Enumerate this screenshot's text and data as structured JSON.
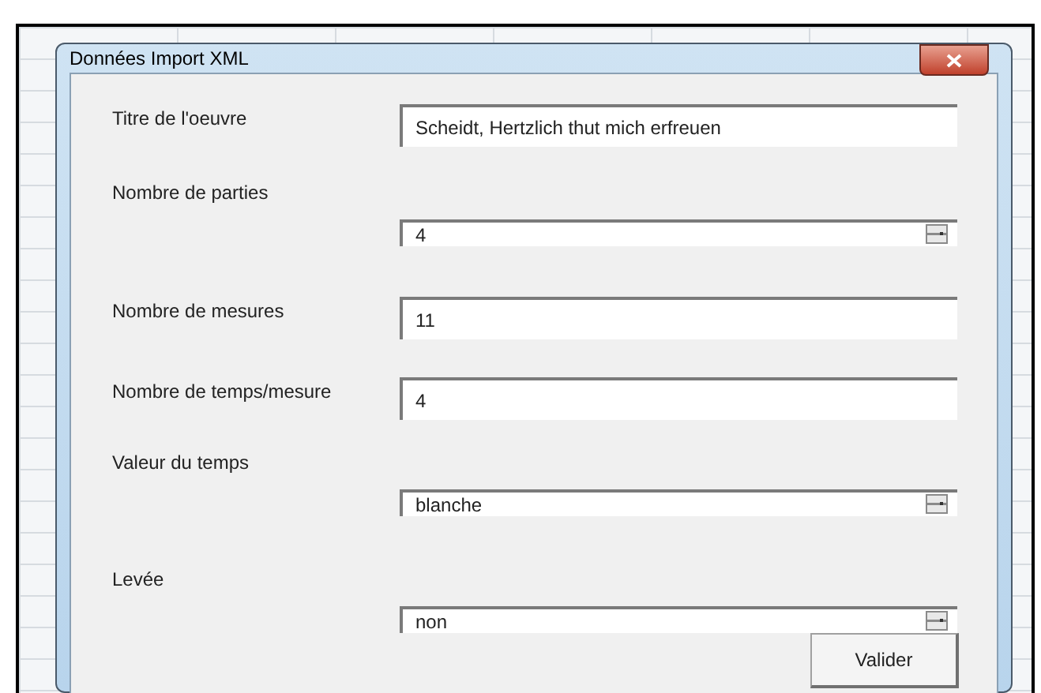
{
  "window": {
    "title": "Données Import XML"
  },
  "fields": [
    {
      "label": "Titre de l'oeuvre",
      "kind": "text",
      "value": "Scheidt, Hertzlich thut mich erfreuen"
    },
    {
      "label": "Nombre de parties",
      "kind": "spin",
      "value": "4"
    },
    {
      "label": "Nombre de mesures",
      "kind": "text",
      "value": "11"
    },
    {
      "label": "Nombre de temps/mesure",
      "kind": "text",
      "value": "4"
    },
    {
      "label": "Valeur du temps",
      "kind": "spin",
      "value": "blanche"
    },
    {
      "label": "Levée",
      "kind": "spin",
      "value": "non"
    }
  ],
  "buttons": [
    "Valider"
  ]
}
